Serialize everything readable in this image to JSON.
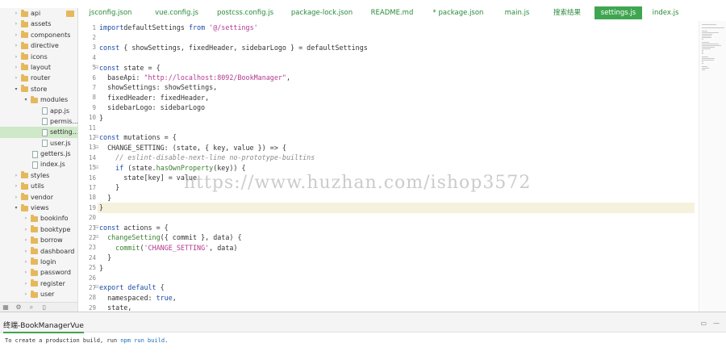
{
  "sidebar": {
    "items": [
      {
        "label": "api",
        "type": "folder",
        "expanded": false,
        "depth": 0
      },
      {
        "label": "assets",
        "type": "folder",
        "expanded": false,
        "depth": 0
      },
      {
        "label": "components",
        "type": "folder",
        "expanded": false,
        "depth": 0
      },
      {
        "label": "directive",
        "type": "folder",
        "expanded": false,
        "depth": 0
      },
      {
        "label": "icons",
        "type": "folder",
        "expanded": false,
        "depth": 0
      },
      {
        "label": "layout",
        "type": "folder",
        "expanded": false,
        "depth": 0
      },
      {
        "label": "router",
        "type": "folder",
        "expanded": false,
        "depth": 0
      },
      {
        "label": "store",
        "type": "folder",
        "expanded": true,
        "depth": 0
      },
      {
        "label": "modules",
        "type": "folder",
        "expanded": true,
        "depth": 1
      },
      {
        "label": "app.js",
        "type": "file",
        "depth": 2
      },
      {
        "label": "permis...",
        "type": "file",
        "depth": 2
      },
      {
        "label": "setting...",
        "type": "file",
        "depth": 2,
        "selected": true
      },
      {
        "label": "user.js",
        "type": "file",
        "depth": 2
      },
      {
        "label": "getters.js",
        "type": "file",
        "depth": 1
      },
      {
        "label": "index.js",
        "type": "file",
        "depth": 1
      },
      {
        "label": "styles",
        "type": "folder",
        "expanded": false,
        "depth": 0
      },
      {
        "label": "utils",
        "type": "folder",
        "expanded": false,
        "depth": 0
      },
      {
        "label": "vendor",
        "type": "folder",
        "expanded": false,
        "depth": 0
      },
      {
        "label": "views",
        "type": "folder",
        "expanded": true,
        "depth": 0
      },
      {
        "label": "bookinfo",
        "type": "folder",
        "expanded": false,
        "depth": 1
      },
      {
        "label": "booktype",
        "type": "folder",
        "expanded": false,
        "depth": 1
      },
      {
        "label": "borrow",
        "type": "folder",
        "expanded": false,
        "depth": 1
      },
      {
        "label": "dashboard",
        "type": "folder",
        "expanded": false,
        "depth": 1
      },
      {
        "label": "login",
        "type": "folder",
        "expanded": false,
        "depth": 1
      },
      {
        "label": "password",
        "type": "folder",
        "expanded": false,
        "depth": 1
      },
      {
        "label": "register",
        "type": "folder",
        "expanded": false,
        "depth": 1
      },
      {
        "label": "user",
        "type": "folder",
        "expanded": false,
        "depth": 1
      }
    ],
    "toolbar_icons": [
      "grid-icon",
      "settings-icon",
      "search-icon",
      "file-icon"
    ]
  },
  "tabs": [
    {
      "label": "jsconfig.json",
      "active": false
    },
    {
      "label": "vue.config.js",
      "active": false
    },
    {
      "label": "postcss.config.js",
      "active": false
    },
    {
      "label": "package-lock.json",
      "active": false
    },
    {
      "label": "README.md",
      "active": false
    },
    {
      "label": "* package.json",
      "active": false
    },
    {
      "label": "main.js",
      "active": false
    },
    {
      "label": "搜索结果",
      "active": false
    },
    {
      "label": "settings.js",
      "active": true
    },
    {
      "label": "index.js",
      "active": false
    }
  ],
  "editor": {
    "highlighted_line": 19,
    "lines": [
      {
        "n": "1",
        "tokens": [
          [
            "kw",
            "import"
          ],
          [
            "",
            "defaultSettings "
          ],
          [
            "kw",
            "from"
          ],
          [
            "",
            " "
          ],
          [
            "str",
            "'@/settings'"
          ]
        ]
      },
      {
        "n": "2",
        "tokens": []
      },
      {
        "n": "3",
        "tokens": [
          [
            "kw",
            "const"
          ],
          [
            "",
            " { showSettings, fixedHeader, sidebarLogo } = defaultSettings"
          ]
        ]
      },
      {
        "n": "4",
        "tokens": []
      },
      {
        "n": "5",
        "tokens": [
          [
            "kw",
            "const"
          ],
          [
            "",
            " state = {"
          ]
        ]
      },
      {
        "n": "6",
        "tokens": [
          [
            "",
            "  baseApi: "
          ],
          [
            "str",
            "\"http://localhost:8092/BookManager\""
          ],
          [
            "",
            ","
          ]
        ]
      },
      {
        "n": "7",
        "tokens": [
          [
            "",
            "  showSettings: showSettings,"
          ]
        ]
      },
      {
        "n": "8",
        "tokens": [
          [
            "",
            "  fixedHeader: fixedHeader,"
          ]
        ]
      },
      {
        "n": "9",
        "tokens": [
          [
            "",
            "  sidebarLogo: sidebarLogo"
          ]
        ]
      },
      {
        "n": "10",
        "tokens": [
          [
            "",
            "}"
          ]
        ]
      },
      {
        "n": "11",
        "tokens": []
      },
      {
        "n": "12",
        "tokens": [
          [
            "kw",
            "const"
          ],
          [
            "",
            " mutations = {"
          ]
        ]
      },
      {
        "n": "13",
        "tokens": [
          [
            "",
            "  CHANGE_SETTING: (state, { key, value }) => {"
          ]
        ]
      },
      {
        "n": "14",
        "tokens": [
          [
            "cm",
            "    // eslint-disable-next-line no-prototype-builtins"
          ]
        ]
      },
      {
        "n": "15",
        "tokens": [
          [
            "",
            "    "
          ],
          [
            "kw",
            "if"
          ],
          [
            "",
            " (state."
          ],
          [
            "fn",
            "hasOwnProperty"
          ],
          [
            "",
            "(key)) {"
          ]
        ]
      },
      {
        "n": "16",
        "tokens": [
          [
            "",
            "      state[key] = value"
          ]
        ]
      },
      {
        "n": "17",
        "tokens": [
          [
            "",
            "    }"
          ]
        ]
      },
      {
        "n": "18",
        "tokens": [
          [
            "",
            "  }"
          ]
        ]
      },
      {
        "n": "19",
        "tokens": [
          [
            "",
            "}"
          ]
        ]
      },
      {
        "n": "20",
        "tokens": []
      },
      {
        "n": "21",
        "tokens": [
          [
            "kw",
            "const"
          ],
          [
            "",
            " actions = {"
          ]
        ]
      },
      {
        "n": "22",
        "tokens": [
          [
            "",
            "  "
          ],
          [
            "fn",
            "changeSetting"
          ],
          [
            "",
            "({ commit }, data) {"
          ]
        ]
      },
      {
        "n": "23",
        "tokens": [
          [
            "",
            "    "
          ],
          [
            "fn",
            "commit"
          ],
          [
            "",
            "("
          ],
          [
            "str",
            "'CHANGE_SETTING'"
          ],
          [
            "",
            ", data)"
          ]
        ]
      },
      {
        "n": "24",
        "tokens": [
          [
            "",
            "  }"
          ]
        ]
      },
      {
        "n": "25",
        "tokens": [
          [
            "",
            "}"
          ]
        ]
      },
      {
        "n": "26",
        "tokens": []
      },
      {
        "n": "27",
        "tokens": [
          [
            "kw",
            "export default"
          ],
          [
            "",
            " {"
          ]
        ]
      },
      {
        "n": "28",
        "tokens": [
          [
            "",
            "  namespaced: "
          ],
          [
            "kw",
            "true"
          ],
          [
            "",
            ","
          ]
        ]
      },
      {
        "n": "29",
        "tokens": [
          [
            "",
            "  state,"
          ]
        ]
      }
    ]
  },
  "watermark": "https://www.huzhan.com/ishop3572",
  "terminal": {
    "title": "终端-BookManagerVue",
    "output_prefix": "To create a production build, run ",
    "output_cmd": "npm run build",
    "output_suffix": "."
  },
  "colors": {
    "accent": "#3fa650",
    "tab_text": "#2a8a3a",
    "keyword": "#1a4aa8",
    "string": "#b3398e",
    "comment": "#8a8a8a",
    "selected_row": "#cfe8c8",
    "highlight_line": "#f4f2dc"
  }
}
